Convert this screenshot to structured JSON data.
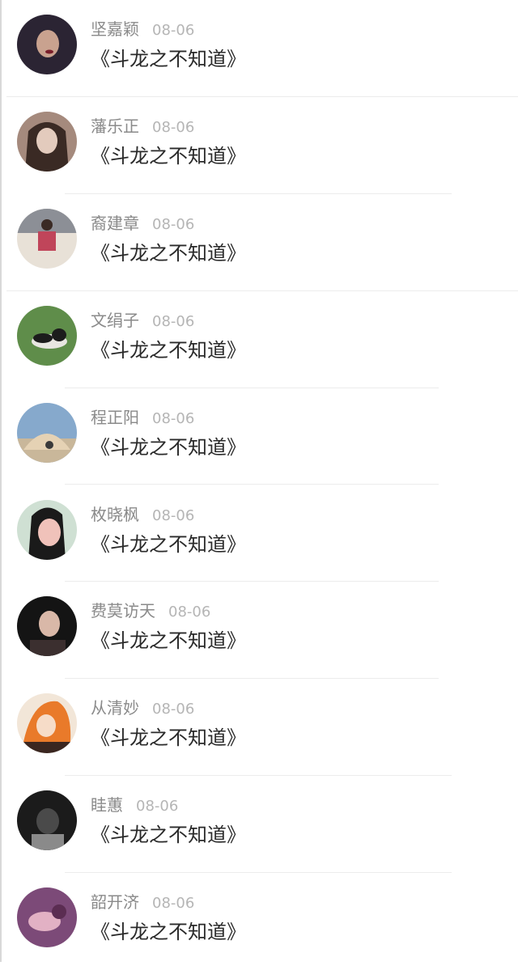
{
  "comments": [
    {
      "name": "坚嘉颖",
      "date": "08-06",
      "title": "《斗龙之不知道》",
      "avatar_colors": [
        "#2b2433",
        "#c9a28f",
        "#7a1e2a"
      ]
    },
    {
      "name": "藩乐正",
      "date": "08-06",
      "title": "《斗龙之不知道》",
      "avatar_colors": [
        "#3a2a24",
        "#e3cbbd",
        "#a58a7d"
      ]
    },
    {
      "name": "裔建章",
      "date": "08-06",
      "title": "《斗龙之不知道》",
      "avatar_colors": [
        "#8c8f96",
        "#c0455a",
        "#e8e1d7"
      ]
    },
    {
      "name": "文绢子",
      "date": "08-06",
      "title": "《斗龙之不知道》",
      "avatar_colors": [
        "#5f8d4a",
        "#1c1c1c",
        "#e8e6e1"
      ]
    },
    {
      "name": "程正阳",
      "date": "08-06",
      "title": "《斗龙之不知道》",
      "avatar_colors": [
        "#86a9cc",
        "#e5d2b4",
        "#3a3a3a"
      ]
    },
    {
      "name": "枚晓枫",
      "date": "08-06",
      "title": "《斗龙之不知道》",
      "avatar_colors": [
        "#cfe0d3",
        "#1a1a1a",
        "#f0c2ba"
      ]
    },
    {
      "name": "费莫访天",
      "date": "08-06",
      "title": "《斗龙之不知道》",
      "avatar_colors": [
        "#141414",
        "#d9b8a8",
        "#3b2f2f"
      ]
    },
    {
      "name": "从清妙",
      "date": "08-06",
      "title": "《斗龙之不知道》",
      "avatar_colors": [
        "#e97a2a",
        "#3a2620",
        "#f6dcc8"
      ]
    },
    {
      "name": "眭蕙",
      "date": "08-06",
      "title": "《斗龙之不知道》",
      "avatar_colors": [
        "#1b1b1b",
        "#4a4a4a",
        "#8a8a8a"
      ]
    },
    {
      "name": "韶开济",
      "date": "08-06",
      "title": "《斗龙之不知道》",
      "avatar_colors": [
        "#7c4a78",
        "#e2b1c4",
        "#5b2d52"
      ]
    }
  ]
}
